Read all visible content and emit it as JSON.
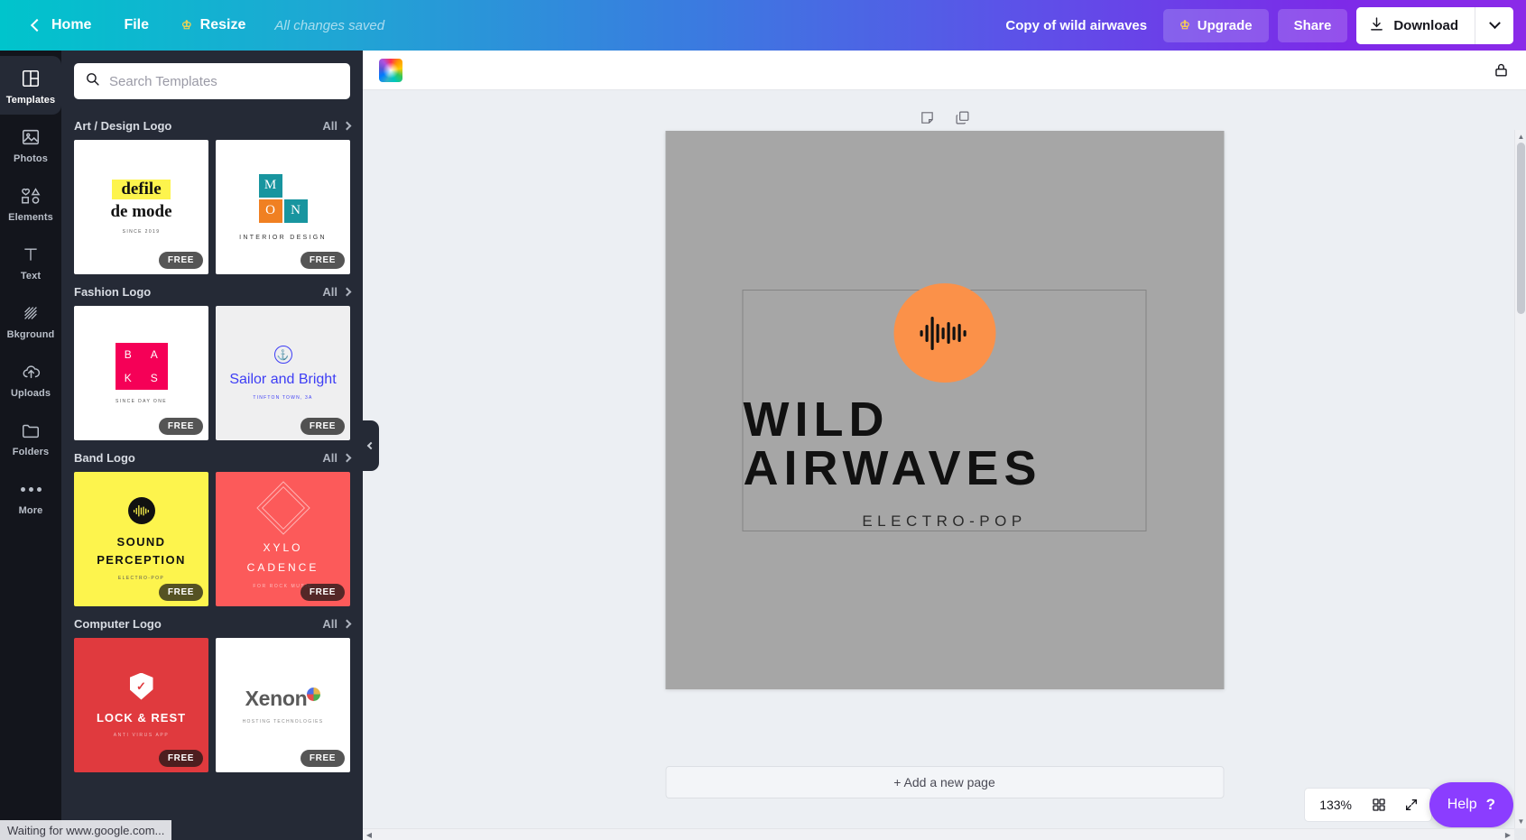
{
  "topbar": {
    "back_label": "Home",
    "file_label": "File",
    "resize_label": "Resize",
    "saved_status": "All changes saved",
    "doc_title": "Copy of wild airwaves",
    "upgrade_label": "Upgrade",
    "share_label": "Share",
    "download_label": "Download"
  },
  "rail": {
    "items": [
      {
        "label": "Templates",
        "icon": "templates-icon",
        "active": true
      },
      {
        "label": "Photos",
        "icon": "photos-icon",
        "active": false
      },
      {
        "label": "Elements",
        "icon": "elements-icon",
        "active": false
      },
      {
        "label": "Text",
        "icon": "text-icon",
        "active": false
      },
      {
        "label": "Bkground",
        "icon": "background-icon",
        "active": false
      },
      {
        "label": "Uploads",
        "icon": "uploads-icon",
        "active": false
      },
      {
        "label": "Folders",
        "icon": "folders-icon",
        "active": false
      },
      {
        "label": "More",
        "icon": "more-icon",
        "active": false
      }
    ]
  },
  "panel": {
    "search_placeholder": "Search Templates",
    "search_value": "",
    "all_label": "All",
    "free_badge": "FREE",
    "categories": [
      {
        "title": "Art / Design Logo",
        "templates": [
          {
            "name": "defile de mode",
            "line1": "defile",
            "line2": "de mode",
            "sub": "SINCE 2019",
            "style": "defile"
          },
          {
            "name": "MOON Interior Design",
            "letters": [
              "M",
              "O",
              "O",
              "N"
            ],
            "sub": "INTERIOR DESIGN",
            "style": "moon"
          }
        ]
      },
      {
        "title": "Fashion Logo",
        "templates": [
          {
            "name": "BAKS",
            "letters": [
              "B",
              "A",
              "K",
              "S"
            ],
            "sub": "SINCE DAY ONE",
            "style": "baks"
          },
          {
            "name": "Sailor and Bright",
            "title": "Sailor and Bright",
            "sub": "TINFTON TOWN, 3A",
            "style": "sailor"
          }
        ]
      },
      {
        "title": "Band Logo",
        "templates": [
          {
            "name": "Sound Perception",
            "line1": "SOUND",
            "line2": "PERCEPTION",
            "sub": "ELECTRO-POP",
            "style": "sound"
          },
          {
            "name": "Xylo Cadence",
            "line1": "XYLO",
            "line2": "CADENCE",
            "sub": "FOR ROCK MUSIC",
            "style": "xylo"
          }
        ]
      },
      {
        "title": "Computer Logo",
        "templates": [
          {
            "name": "Lock & Rest",
            "title": "LOCK & REST",
            "sub": "ANTI VIRUS APP",
            "style": "lock"
          },
          {
            "name": "Xenon",
            "title": "Xenon",
            "sub": "HOSTING TECHNOLOGIES",
            "style": "xenon"
          }
        ]
      }
    ]
  },
  "canvas": {
    "logo_title": "WILD AIRWAVES",
    "logo_subtitle": "ELECTRO-POP",
    "add_page_label": "+ Add a new page",
    "zoom_level": "133%",
    "help_label": "Help",
    "help_mark": "?"
  },
  "status": {
    "message": "Waiting for www.google.com..."
  },
  "colors": {
    "accent_purple": "#8b3dff",
    "brand_teal": "#00c4cc",
    "logo_orange": "#fb9149",
    "canvas_gray": "#a6a6a6"
  }
}
